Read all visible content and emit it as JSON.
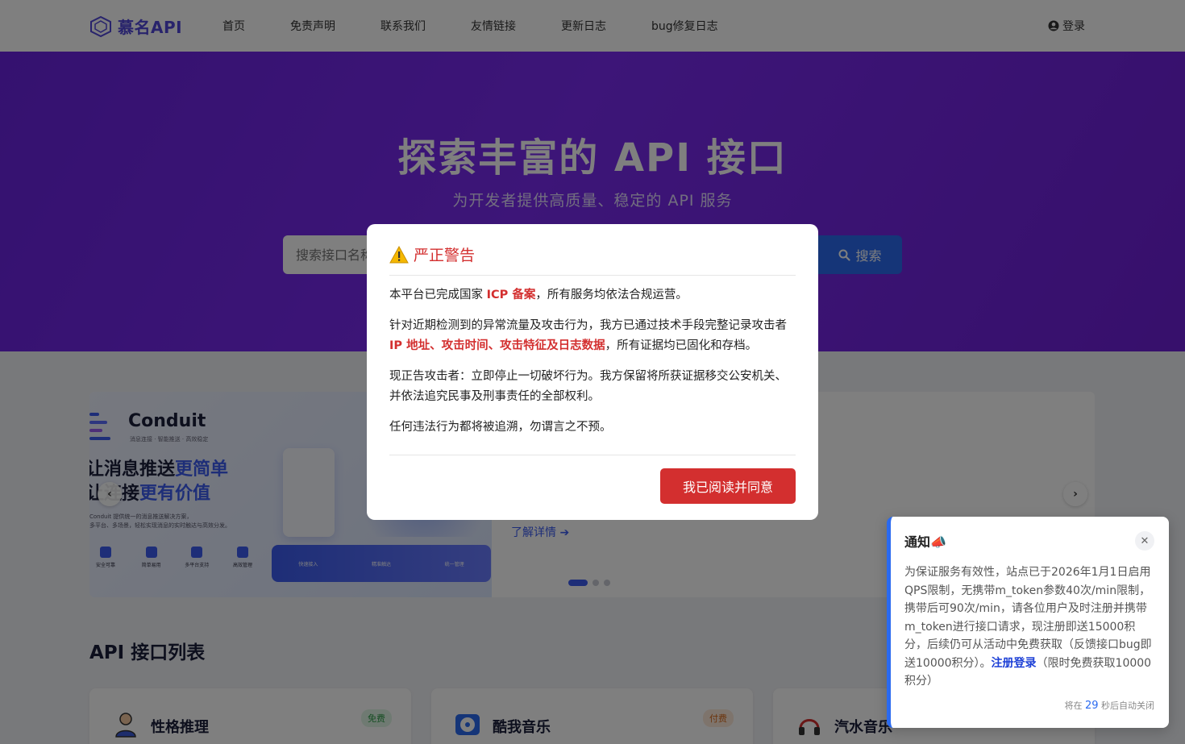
{
  "nav": {
    "logo_text": "慕名API",
    "links": [
      "首页",
      "免责声明",
      "联系我们",
      "友情链接",
      "更新日志",
      "bug修复日志"
    ],
    "login": "登录"
  },
  "hero": {
    "title": "探索丰富的 API 接口",
    "subtitle": "为开发者提供高质量、稳定的 API 服务",
    "search_placeholder": "搜索接口名称",
    "search_button": "搜索"
  },
  "carousel": {
    "brand": "Conduit",
    "brand_sub": "消息连接 · 智能推送 · 高效稳定",
    "headline1_a": "让消息推送",
    "headline1_b": "更简单",
    "headline2_a": "让连接",
    "headline2_b": "更有价值",
    "desc_line1": "Conduit 提供统一的消息推送解决方案，",
    "desc_line2": "多平台、多场景，轻松实现消息的实时触达与高效分发。",
    "features": [
      "安全可靠",
      "简单易用",
      "多平台支持",
      "高效管理"
    ],
    "bar_items": [
      "快速接入",
      "精准触达",
      "统一管理"
    ],
    "link_text": "了解详情",
    "dots": 3,
    "active_dot": 0
  },
  "list": {
    "title": "API 接口列表",
    "cards": [
      {
        "name": "性格推理",
        "badge": "免费",
        "badge_type": "free"
      },
      {
        "name": "酷我音乐",
        "badge": "付费",
        "badge_type": "paid"
      },
      {
        "name": "汽水音乐",
        "badge": "",
        "badge_type": ""
      }
    ]
  },
  "modal": {
    "title": "严正警告",
    "p1_a": "本平台已完成国家 ",
    "p1_hl": "ICP 备案",
    "p1_b": "，所有服务均依法合规运营。",
    "p2_a": "针对近期检测到的异常流量及攻击行为，我方已通过技术手段完整记录攻击者 ",
    "p2_hl": "IP 地址、攻击时间、攻击特征及日志数据",
    "p2_b": "，所有证据均已固化和存档。",
    "p3": "现正告攻击者：立即停止一切破坏行为。我方保留将所获证据移交公安机关、并依法追究民事及刑事责任的全部权利。",
    "p4": "任何违法行为都将被追溯，勿谓言之不预。",
    "button": "我已阅读并同意"
  },
  "notice": {
    "title": "通知📣",
    "body_a": "为保证服务有效性，站点已于2026年1月1日启用QPS限制，无携带m_token参数40次/min限制，携带后可90次/min，请各位用户及时注册并携带m_token进行接口请求，现注册即送15000积分，后续仍可从活动中免费获取（反馈接口bug即送10000积分）。",
    "link": "注册登录",
    "body_b": "（限时免费获取10000积分）",
    "foot_a": "将在 ",
    "countdown": "29",
    "foot_b": " 秒后自动关闭"
  },
  "colors": {
    "brand": "#5146d8",
    "hero": "#7a2bf0",
    "primary": "#2a6af0",
    "danger": "#d32f2f"
  }
}
